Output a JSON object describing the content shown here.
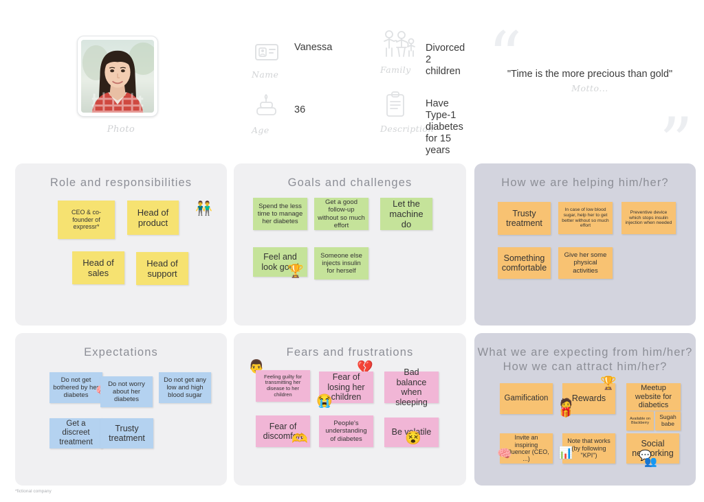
{
  "header": {
    "photo": {
      "label": "Photo",
      "alt": "portrait-photo-of-woman"
    },
    "fields": [
      {
        "caption": "Name",
        "value": "Vanessa",
        "icon": "id-card-icon"
      },
      {
        "caption": "Family",
        "value": "Divorced\n2 children",
        "icon": "family-icon"
      },
      {
        "caption": "Age",
        "value": "36",
        "icon": "birthday-cake-icon"
      },
      {
        "caption": "Description",
        "value": "Have Type-1 diabetes\nfor 15 years",
        "icon": "clipboard-icon"
      }
    ],
    "motto": {
      "text": "\"Time is the more precious than gold\"",
      "caption": "Motto...",
      "quote_open": "“",
      "quote_close": "”"
    }
  },
  "panels": [
    {
      "id": "role-and-responsibilities",
      "title": "Role and responsibilities",
      "theme": "gray",
      "note_color": "yellow",
      "notes": [
        {
          "text": "CEO & co-founder of expressr*",
          "size": "small"
        },
        {
          "text": "Head of product",
          "size": "large"
        },
        {
          "text": "Head of sales",
          "size": "large"
        },
        {
          "text": "Head of support",
          "size": "large"
        }
      ],
      "emojis": [
        {
          "name": "people-hugging-icon",
          "glyph": "👬"
        }
      ]
    },
    {
      "id": "goals-and-challenges",
      "title": "Goals and challenges",
      "theme": "gray",
      "note_color": "green",
      "notes": [
        {
          "text": "Spend the less time to manage her diabetes",
          "size": "small"
        },
        {
          "text": "Get a good follow-up without so much effort",
          "size": "small"
        },
        {
          "text": "Let the machine do",
          "size": "large"
        },
        {
          "text": "Feel and look good",
          "size": "large"
        },
        {
          "text": "Someone else injects insulin for herself",
          "size": "small"
        }
      ],
      "emojis": [
        {
          "name": "trophy-icon",
          "glyph": "🏆"
        }
      ]
    },
    {
      "id": "how-we-are-helping",
      "title": "How we are helping him/her?",
      "theme": "accent",
      "note_color": "orange",
      "notes": [
        {
          "text": "Trusty treatment",
          "size": "large"
        },
        {
          "text": "In case of low blood sugar, help her to get better without so much effort",
          "size": "tiny"
        },
        {
          "text": "Preventive device which stops insulin injection when needed",
          "size": "tiny"
        },
        {
          "text": "Something comfortable",
          "size": "large"
        },
        {
          "text": "Give her some physical activities",
          "size": "small"
        }
      ],
      "emojis": []
    },
    {
      "id": "expectations",
      "title": "Expectations",
      "theme": "gray",
      "note_color": "blue",
      "notes": [
        {
          "text": "Do not get bothered by her diabetes",
          "size": "small"
        },
        {
          "text": "Do not worry about her diabetes",
          "size": "small"
        },
        {
          "text": "Do not get any low and high blood sugar",
          "size": "small"
        },
        {
          "text": "Get a discreet treatment",
          "size": "large"
        },
        {
          "text": "Trusty treatment",
          "size": "large"
        }
      ],
      "emojis": [
        {
          "name": "head-with-gears-icon",
          "glyph": "🧠"
        }
      ]
    },
    {
      "id": "fears-and-frustrations",
      "title": "Fears and frustrations",
      "theme": "gray",
      "note_color": "pink",
      "notes": [
        {
          "text": "Feeling guilty for transmitting her disease to her children",
          "size": "tiny"
        },
        {
          "text": "Fear of losing her children",
          "size": "large"
        },
        {
          "text": "Bad balance when sleeping",
          "size": "large"
        },
        {
          "text": "Fear of discomfort",
          "size": "large"
        },
        {
          "text": "People's understanding of diabetes",
          "size": "small"
        },
        {
          "text": "Be volatile",
          "size": "large"
        }
      ],
      "emojis": [
        {
          "name": "person-icon",
          "glyph": "👨"
        },
        {
          "name": "broken-heart-icon",
          "glyph": "💔"
        },
        {
          "name": "crying-face-icon",
          "glyph": "😭"
        },
        {
          "name": "heart-hands-icon",
          "glyph": "🫶"
        },
        {
          "name": "dizzy-face-icon",
          "glyph": "😵"
        }
      ]
    },
    {
      "id": "what-we-are-expecting",
      "title": "What we are expecting from him/her?\nHow we can attract him/her?",
      "theme": "accent",
      "note_color": "orange",
      "notes": [
        {
          "text": "Gamification",
          "size": "large"
        },
        {
          "text": "Rewards",
          "size": "large"
        },
        {
          "text": "Meetup website for diabetics",
          "size": "large"
        },
        {
          "text": "Available on Blackberry",
          "size": "micro"
        },
        {
          "text": "Sugah babe",
          "size": "micro"
        },
        {
          "text": "Invite an inspiring influencer (CEO, ...)",
          "size": "small"
        },
        {
          "text": "Note that works (by following \"KPI\")",
          "size": "small"
        },
        {
          "text": "Social networking",
          "size": "large"
        }
      ],
      "emojis": [
        {
          "name": "trophy-icon",
          "glyph": "🏆"
        },
        {
          "name": "person-badge-icon",
          "glyph": "🧑"
        },
        {
          "name": "gift-box-icon",
          "glyph": "🎁"
        },
        {
          "name": "head-with-gears-icon",
          "glyph": "🧠"
        },
        {
          "name": "chart-analysis-icon",
          "glyph": "📊"
        },
        {
          "name": "speech-bubble-icon",
          "glyph": "💬"
        },
        {
          "name": "social-group-icon",
          "glyph": "👥"
        }
      ]
    }
  ],
  "footnote": "*fictional company"
}
